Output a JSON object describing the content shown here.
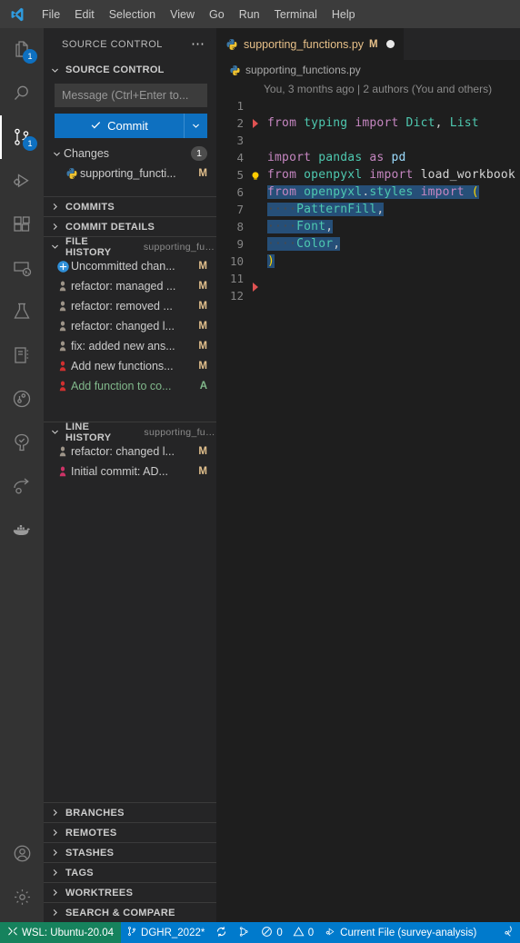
{
  "titlebar": {
    "logo_icon": "vscode-logo-icon",
    "menus": [
      "File",
      "Edit",
      "Selection",
      "View",
      "Go",
      "Run",
      "Terminal",
      "Help"
    ]
  },
  "activitybar": {
    "items": [
      {
        "name": "explorer",
        "icon": "files-icon",
        "badge": "1",
        "active": false
      },
      {
        "name": "search",
        "icon": "search-icon",
        "badge": "",
        "active": false
      },
      {
        "name": "source-control",
        "icon": "source-control-icon",
        "badge": "1",
        "active": true
      },
      {
        "name": "run-and-debug",
        "icon": "run-debug-icon",
        "badge": "",
        "active": false
      },
      {
        "name": "extensions",
        "icon": "extensions-icon",
        "badge": "",
        "active": false
      },
      {
        "name": "remote-explorer",
        "icon": "remote-explorer-icon",
        "badge": "",
        "active": false
      },
      {
        "name": "testing",
        "icon": "beaker-icon",
        "badge": "",
        "active": false
      },
      {
        "name": "notebook",
        "icon": "notebook-icon",
        "badge": "",
        "active": false
      },
      {
        "name": "timeline",
        "icon": "clock-git-icon",
        "badge": "",
        "active": false
      },
      {
        "name": "todo-tree",
        "icon": "tree-check-icon",
        "badge": "",
        "active": false
      },
      {
        "name": "share",
        "icon": "share-arrow-icon",
        "badge": "",
        "active": false
      },
      {
        "name": "docker",
        "icon": "docker-whale-icon",
        "badge": "",
        "active": false
      }
    ],
    "bottom_items": [
      {
        "name": "accounts",
        "icon": "account-icon"
      },
      {
        "name": "manage",
        "icon": "gear-icon"
      }
    ]
  },
  "sidebar": {
    "title": "SOURCE CONTROL",
    "more_actions_icon": "ellipsis-icon",
    "source_control": {
      "header": "SOURCE CONTROL",
      "input_placeholder": "Message (Ctrl+Enter to...",
      "input_value": "",
      "commit_label": "Commit",
      "commit_check_icon": "check-icon",
      "commit_dropdown_icon": "chevron-down-icon"
    },
    "changes": {
      "header": "Changes",
      "count": "1",
      "items": [
        {
          "icon": "python-file-icon",
          "label": "supporting_functi...",
          "status": "M"
        }
      ]
    },
    "collapsed_sections_mid": [
      {
        "label": "COMMITS"
      },
      {
        "label": "COMMIT DETAILS"
      }
    ],
    "file_history": {
      "header": "FILE HISTORY",
      "subtitle": "supporting_fun...",
      "items": [
        {
          "icon": "uncommitted-icon",
          "label": "Uncommitted chan...",
          "status": "M",
          "green": false
        },
        {
          "icon": "avatar-grey-icon",
          "label": "refactor: managed ...",
          "status": "M",
          "green": false
        },
        {
          "icon": "avatar-grey-icon",
          "label": "refactor: removed ...",
          "status": "M",
          "green": false
        },
        {
          "icon": "avatar-grey-icon",
          "label": "refactor: changed l...",
          "status": "M",
          "green": false
        },
        {
          "icon": "avatar-grey-icon",
          "label": "fix: added new ans...",
          "status": "M",
          "green": false
        },
        {
          "icon": "avatar-red-icon",
          "label": "Add new functions...",
          "status": "M",
          "green": false
        },
        {
          "icon": "avatar-red-icon",
          "label": "Add function to co...",
          "status": "A",
          "green": true
        }
      ]
    },
    "line_history": {
      "header": "LINE HISTORY",
      "subtitle": "supporting_fun...",
      "items": [
        {
          "icon": "avatar-grey-icon",
          "label": "refactor: changed l...",
          "status": "M"
        },
        {
          "icon": "avatar-pink-icon",
          "label": "Initial commit: AD...",
          "status": "M"
        }
      ]
    },
    "collapsed_sections_bottom": [
      {
        "label": "BRANCHES"
      },
      {
        "label": "REMOTES"
      },
      {
        "label": "STASHES"
      },
      {
        "label": "TAGS"
      },
      {
        "label": "WORKTREES"
      },
      {
        "label": "SEARCH & COMPARE"
      }
    ]
  },
  "editor": {
    "tab": {
      "icon": "python-file-icon",
      "filename": "supporting_functions.py",
      "modified_flag": "M",
      "dirty_icon": "dirty-dot-icon"
    },
    "breadcrumb": {
      "icon": "python-file-icon",
      "text": "supporting_functions.py"
    },
    "blame": "You, 3 months ago | 2 authors (You and others)",
    "line_numbers": [
      "1",
      "2",
      "3",
      "4",
      "5",
      "6",
      "7",
      "8",
      "9",
      "10",
      "11",
      "12"
    ],
    "code_lines": [
      {
        "n": "1",
        "text": "",
        "diff": false
      },
      {
        "n": "2",
        "text": "from typing import Dict, List",
        "diff": true
      },
      {
        "n": "3",
        "text": "",
        "diff": false
      },
      {
        "n": "4",
        "text": "import pandas as pd",
        "diff": false
      },
      {
        "n": "5",
        "text": "from openpyxl import load_workbook",
        "diff": false
      },
      {
        "n": "6",
        "text": "from openpyxl.styles import (",
        "diff": false
      },
      {
        "n": "7",
        "text": "    PatternFill,",
        "diff": false
      },
      {
        "n": "8",
        "text": "    Font,",
        "diff": false
      },
      {
        "n": "9",
        "text": "    Color,",
        "diff": false
      },
      {
        "n": "10",
        "text": ")",
        "diff": false
      },
      {
        "n": "11",
        "text": "",
        "diff": true
      },
      {
        "n": "12",
        "text": "",
        "diff": false
      }
    ],
    "lightbulb_icon": "lightbulb-icon",
    "selection_color": "#264f78"
  },
  "statusbar": {
    "remote": {
      "icon": "remote-indicator-icon",
      "label": "WSL: Ubuntu-20.04"
    },
    "branch": {
      "icon": "source-control-icon",
      "label": "DGHR_2022*"
    },
    "sync": {
      "icon": "sync-icon",
      "label": ""
    },
    "git_graph": {
      "icon": "git-graph-icon",
      "label": ""
    },
    "errors": {
      "icon": "error-icon",
      "label": "0"
    },
    "warnings": {
      "icon": "warning-icon",
      "label": "0"
    },
    "interpreter": {
      "icon": "run-debug-icon",
      "label": "Current File (survey-analysis)"
    },
    "right": {
      "icon": "radio-tower-icon",
      "label": ""
    }
  },
  "colors": {
    "accent_blue": "#007acc",
    "button_blue": "#0e70c0",
    "remote_green": "#16825d",
    "editor_bg": "#1e1e1e",
    "sidebar_bg": "#252526",
    "activitybar_bg": "#333333",
    "titlebar_bg": "#3c3c3c",
    "modified_amber": "#e2c08d",
    "added_green": "#81b88b"
  }
}
